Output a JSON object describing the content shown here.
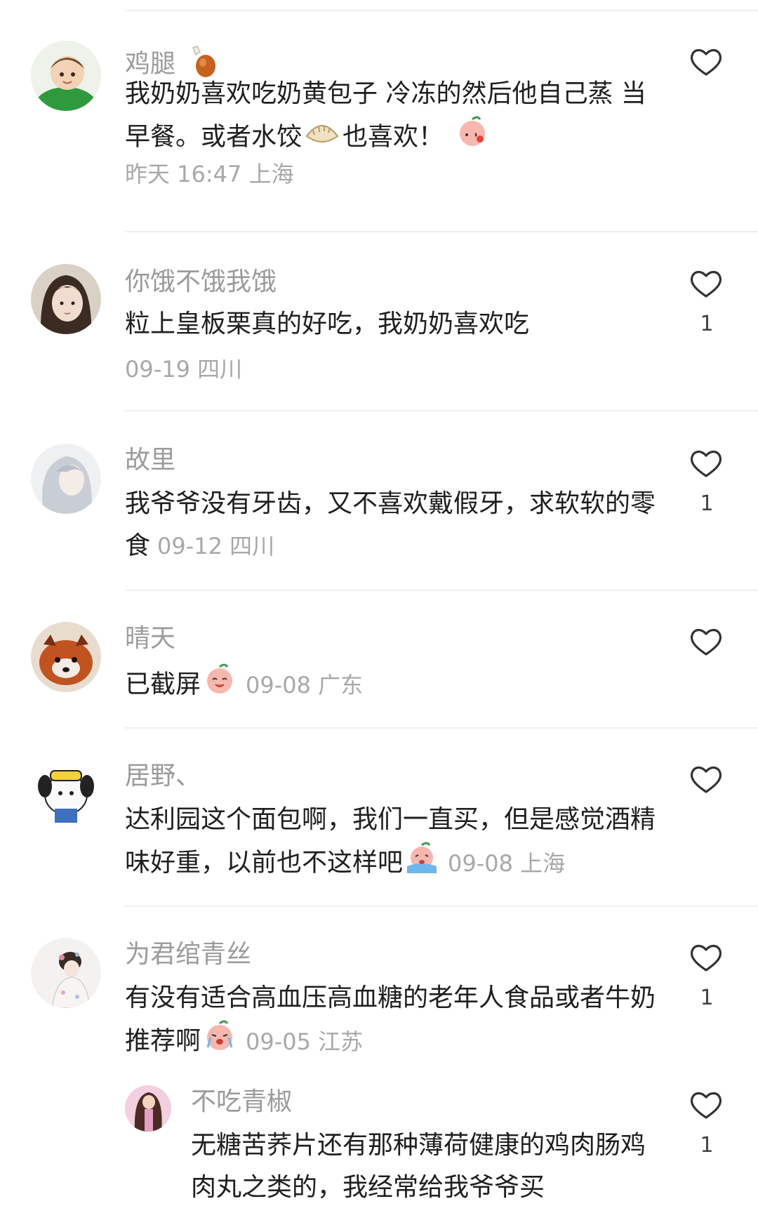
{
  "comments": [
    {
      "username": "鸡腿",
      "text": "我奶奶喜欢吃奶黄包子 冷冻的然后他自己蒸 当早餐。或者水饺",
      "text_tail": "也喜欢！",
      "meta": "昨天 16:47 上海",
      "likes": ""
    },
    {
      "username": "你饿不饿我饿",
      "text": "粒上皇板栗真的好吃，我奶奶喜欢吃",
      "meta": "09-19 四川",
      "likes": "1"
    },
    {
      "username": "故里",
      "text": "我爷爷没有牙齿，又不喜欢戴假牙，求软软的零食",
      "meta": "09-12 四川",
      "likes": "1"
    },
    {
      "username": "晴天",
      "text": "已截屏",
      "meta": "09-08 广东",
      "likes": ""
    },
    {
      "username": "居野、",
      "text": "达利园这个面包啊，我们一直买，但是感觉酒精味好重，以前也不这样吧",
      "meta": "09-08 上海",
      "likes": ""
    },
    {
      "username": "为君绾青丝",
      "text": "有没有适合高血压高血糖的老年人食品或者牛奶推荐啊",
      "meta": "09-05 江苏",
      "likes": "1"
    },
    {
      "username": "不吃青椒",
      "text": "无糖苦荞片还有那种薄荷健康的鸡肉肠鸡肉丸之类的，我经常给我爷爷买",
      "likes": "1"
    }
  ],
  "colors": {
    "username": "#9b9b9b",
    "meta": "#a8a8a8",
    "text": "#1f1f1f",
    "divider": "#f0f0f0"
  },
  "icons": [
    "heart-outline-icon",
    "drumstick-emoji",
    "dumpling-emoji",
    "peach-blush-emoji",
    "peach-smile-emoji",
    "peach-cry-emoji"
  ]
}
